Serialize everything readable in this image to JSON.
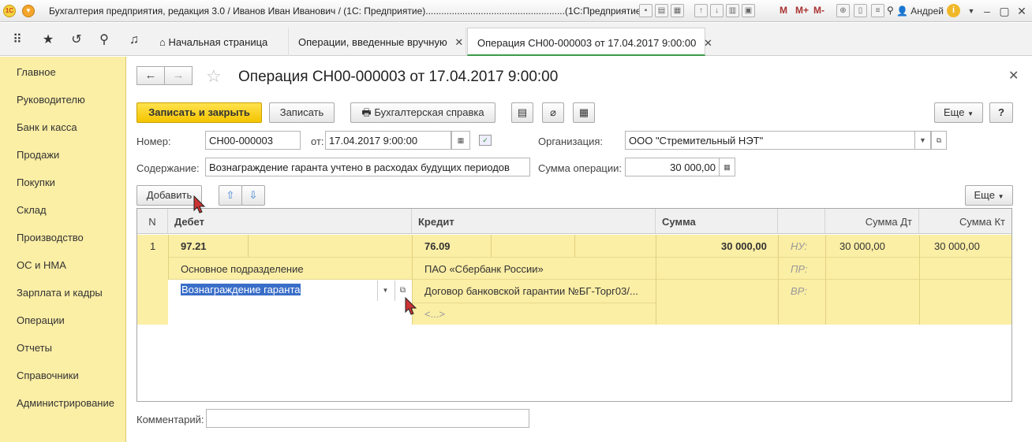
{
  "titlebar": {
    "logo": "1С",
    "title": "Бухгалтерия предприятия, редакция 3.0 / Иванов Иван Иванович / (1С: Предприятие).....................................................(1С:Предприятие)",
    "m1": "M",
    "m2": "M+",
    "m3": "M-",
    "user": "Андрей",
    "info": "i"
  },
  "tabs": [
    {
      "label": "Начальная страница"
    },
    {
      "label": "Операции, введенные вручную"
    },
    {
      "label": "Операция СН00-000003 от 17.04.2017 9:00:00"
    }
  ],
  "sidebar": {
    "items": [
      "Главное",
      "Руководителю",
      "Банк и касса",
      "Продажи",
      "Покупки",
      "Склад",
      "Производство",
      "ОС и НМА",
      "Зарплата и кадры",
      "Операции",
      "Отчеты",
      "Справочники",
      "Администрирование"
    ]
  },
  "form": {
    "title": "Операция СН00-000003 от 17.04.2017 9:00:00",
    "toolbar": {
      "save_close": "Записать и закрыть",
      "save": "Записать",
      "report": "Бухгалтерская справка",
      "more": "Еще",
      "help": "?"
    },
    "fields": {
      "number_label": "Номер:",
      "number_value": "СН00-000003",
      "date_label": "от:",
      "date_value": "17.04.2017  9:00:00",
      "org_label": "Организация:",
      "org_value": "ООО \"Стремительный НЭТ\"",
      "content_label": "Содержание:",
      "content_value": "Вознаграждение гаранта учтено в расходах будущих периодов",
      "sum_label": "Сумма операции:",
      "sum_value": "30 000,00"
    },
    "table_toolbar": {
      "add": "Добавить",
      "more": "Еще"
    },
    "table": {
      "headers": [
        "N",
        "Дебет",
        "Кредит",
        "Сумма",
        "",
        "Сумма Дт",
        "Сумма Кт"
      ],
      "row": {
        "n": "1",
        "debit_account": "97.21",
        "debit_sub1": "Основное подразделение",
        "debit_sub2": "Вознаграждение гаранта",
        "credit_account": "76.09",
        "credit_sub1": "ПАО «Сбербанк России»",
        "credit_sub2": "Договор банковской гарантии №БГ-Торг03/...",
        "credit_sub3": "<...>",
        "sum": "30 000,00",
        "tax_nu": "НУ:",
        "tax_pr": "ПР:",
        "tax_vr": "ВР:",
        "sum_dt": "30 000,00",
        "sum_kt": "30 000,00"
      }
    },
    "comment_label": "Комментарий:",
    "comment_value": ""
  }
}
